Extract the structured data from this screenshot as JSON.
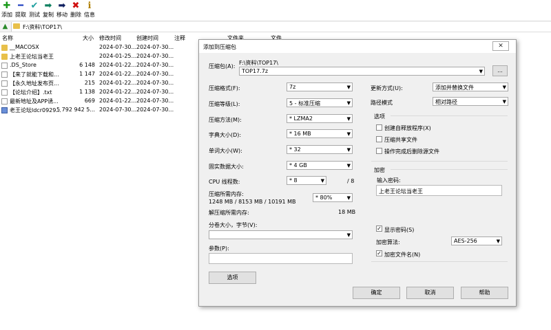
{
  "toolbar": {
    "buttons": [
      {
        "label": "添加",
        "icon": "add-icon",
        "glyph": "✚",
        "color": "#1a9a1a"
      },
      {
        "label": "提取",
        "icon": "extract-icon",
        "glyph": "━",
        "color": "#2040c0"
      },
      {
        "label": "测试",
        "icon": "test-icon",
        "glyph": "✔",
        "color": "#20a0a0"
      },
      {
        "label": "复制",
        "icon": "copy-icon",
        "glyph": "➡",
        "color": "#108060"
      },
      {
        "label": "移动",
        "icon": "move-icon",
        "glyph": "➡",
        "color": "#102060"
      },
      {
        "label": "删除",
        "icon": "delete-icon",
        "glyph": "✖",
        "color": "#d01010"
      },
      {
        "label": "信息",
        "icon": "info-icon",
        "glyph": "ℹ",
        "color": "#b08000"
      }
    ]
  },
  "address": {
    "path": "F:\\资料\\TOP17\\"
  },
  "file_list": {
    "headers": {
      "name": "名称",
      "size": "大小",
      "modified": "修改时间",
      "created": "创建时间",
      "comment": "注释",
      "folders": "文件夹",
      "files": "文件"
    },
    "rows": [
      {
        "type": "folder",
        "name": "__MACOSX",
        "size": "",
        "modified": "2024-07-30...",
        "created": "2024-07-30..."
      },
      {
        "type": "folder",
        "name": "上老王论坛当老王",
        "size": "",
        "modified": "2024-01-25...",
        "created": "2024-07-30..."
      },
      {
        "type": "doc",
        "name": ".DS_Store",
        "size": "6 148",
        "modified": "2024-01-22...",
        "created": "2024-07-30..."
      },
      {
        "type": "doc",
        "name": "【来了就能下载和...",
        "size": "1 147",
        "modified": "2024-01-22...",
        "created": "2024-07-30..."
      },
      {
        "type": "doc",
        "name": "【永久地址发布页...",
        "size": "215",
        "modified": "2024-01-22...",
        "created": "2024-07-30..."
      },
      {
        "type": "doc",
        "name": "【论坛介绍】.txt",
        "size": "1 138",
        "modified": "2024-01-22...",
        "created": "2024-07-30..."
      },
      {
        "type": "doc",
        "name": "最新地址及APP诱...",
        "size": "669",
        "modified": "2024-01-22...",
        "created": "2024-07-30..."
      },
      {
        "type": "archive",
        "name": "老王论坛ldcr0929...",
        "size": "5 792 942 5...",
        "modified": "2024-07-30...",
        "created": "2024-07-30..."
      }
    ]
  },
  "dialog": {
    "title": "添加到压缩包",
    "close_glyph": "✕",
    "archive_label": "压缩包(A):",
    "archive_path": "F:\\资料\\TOP17\\",
    "archive_name": "TOP17.7z",
    "browse_label": "...",
    "format_label": "压缩格式(F):",
    "format_value": "7z",
    "level_label": "压缩等级(L):",
    "level_value": "5 - 标准压缩",
    "method_label": "压缩方法(M):",
    "method_value": "* LZMA2",
    "dict_label": "字典大小(D):",
    "dict_value": "* 16 MB",
    "word_label": "单词大小(W):",
    "word_value": "* 32",
    "solid_label": "固实数据大小:",
    "solid_value": "* 4 GB",
    "threads_label": "CPU 线程数:",
    "threads_value": "* 8",
    "threads_total": "/ 8",
    "mem_label": "压缩所需内存:",
    "mem_detail": "1248 MB / 8153 MB / 10191 MB",
    "mem_value": "* 80%",
    "decomp_label": "解压缩所需内存:",
    "decomp_value": "18 MB",
    "split_label": "分卷大小，字节(V):",
    "split_value": "",
    "params_label": "参数(P):",
    "params_value": "",
    "options_button": "选项",
    "update_label": "更新方式(U):",
    "update_value": "添加并替换文件",
    "pathmode_label": "路径模式",
    "pathmode_value": "相对路径",
    "options_group": "选项",
    "opt_sfx": "创建自释放程序(X)",
    "opt_shared": "压缩共享文件",
    "opt_delete": "操作完成后删除源文件",
    "encrypt_group": "加密",
    "password_label": "输入密码:",
    "password_value": "上老王论坛当老王",
    "show_password": "显示密码(S)",
    "enc_method_label": "加密算法:",
    "enc_method_value": "AES-256",
    "encrypt_names": "加密文件名(N)",
    "ok": "确定",
    "cancel": "取消",
    "help": "帮助"
  }
}
